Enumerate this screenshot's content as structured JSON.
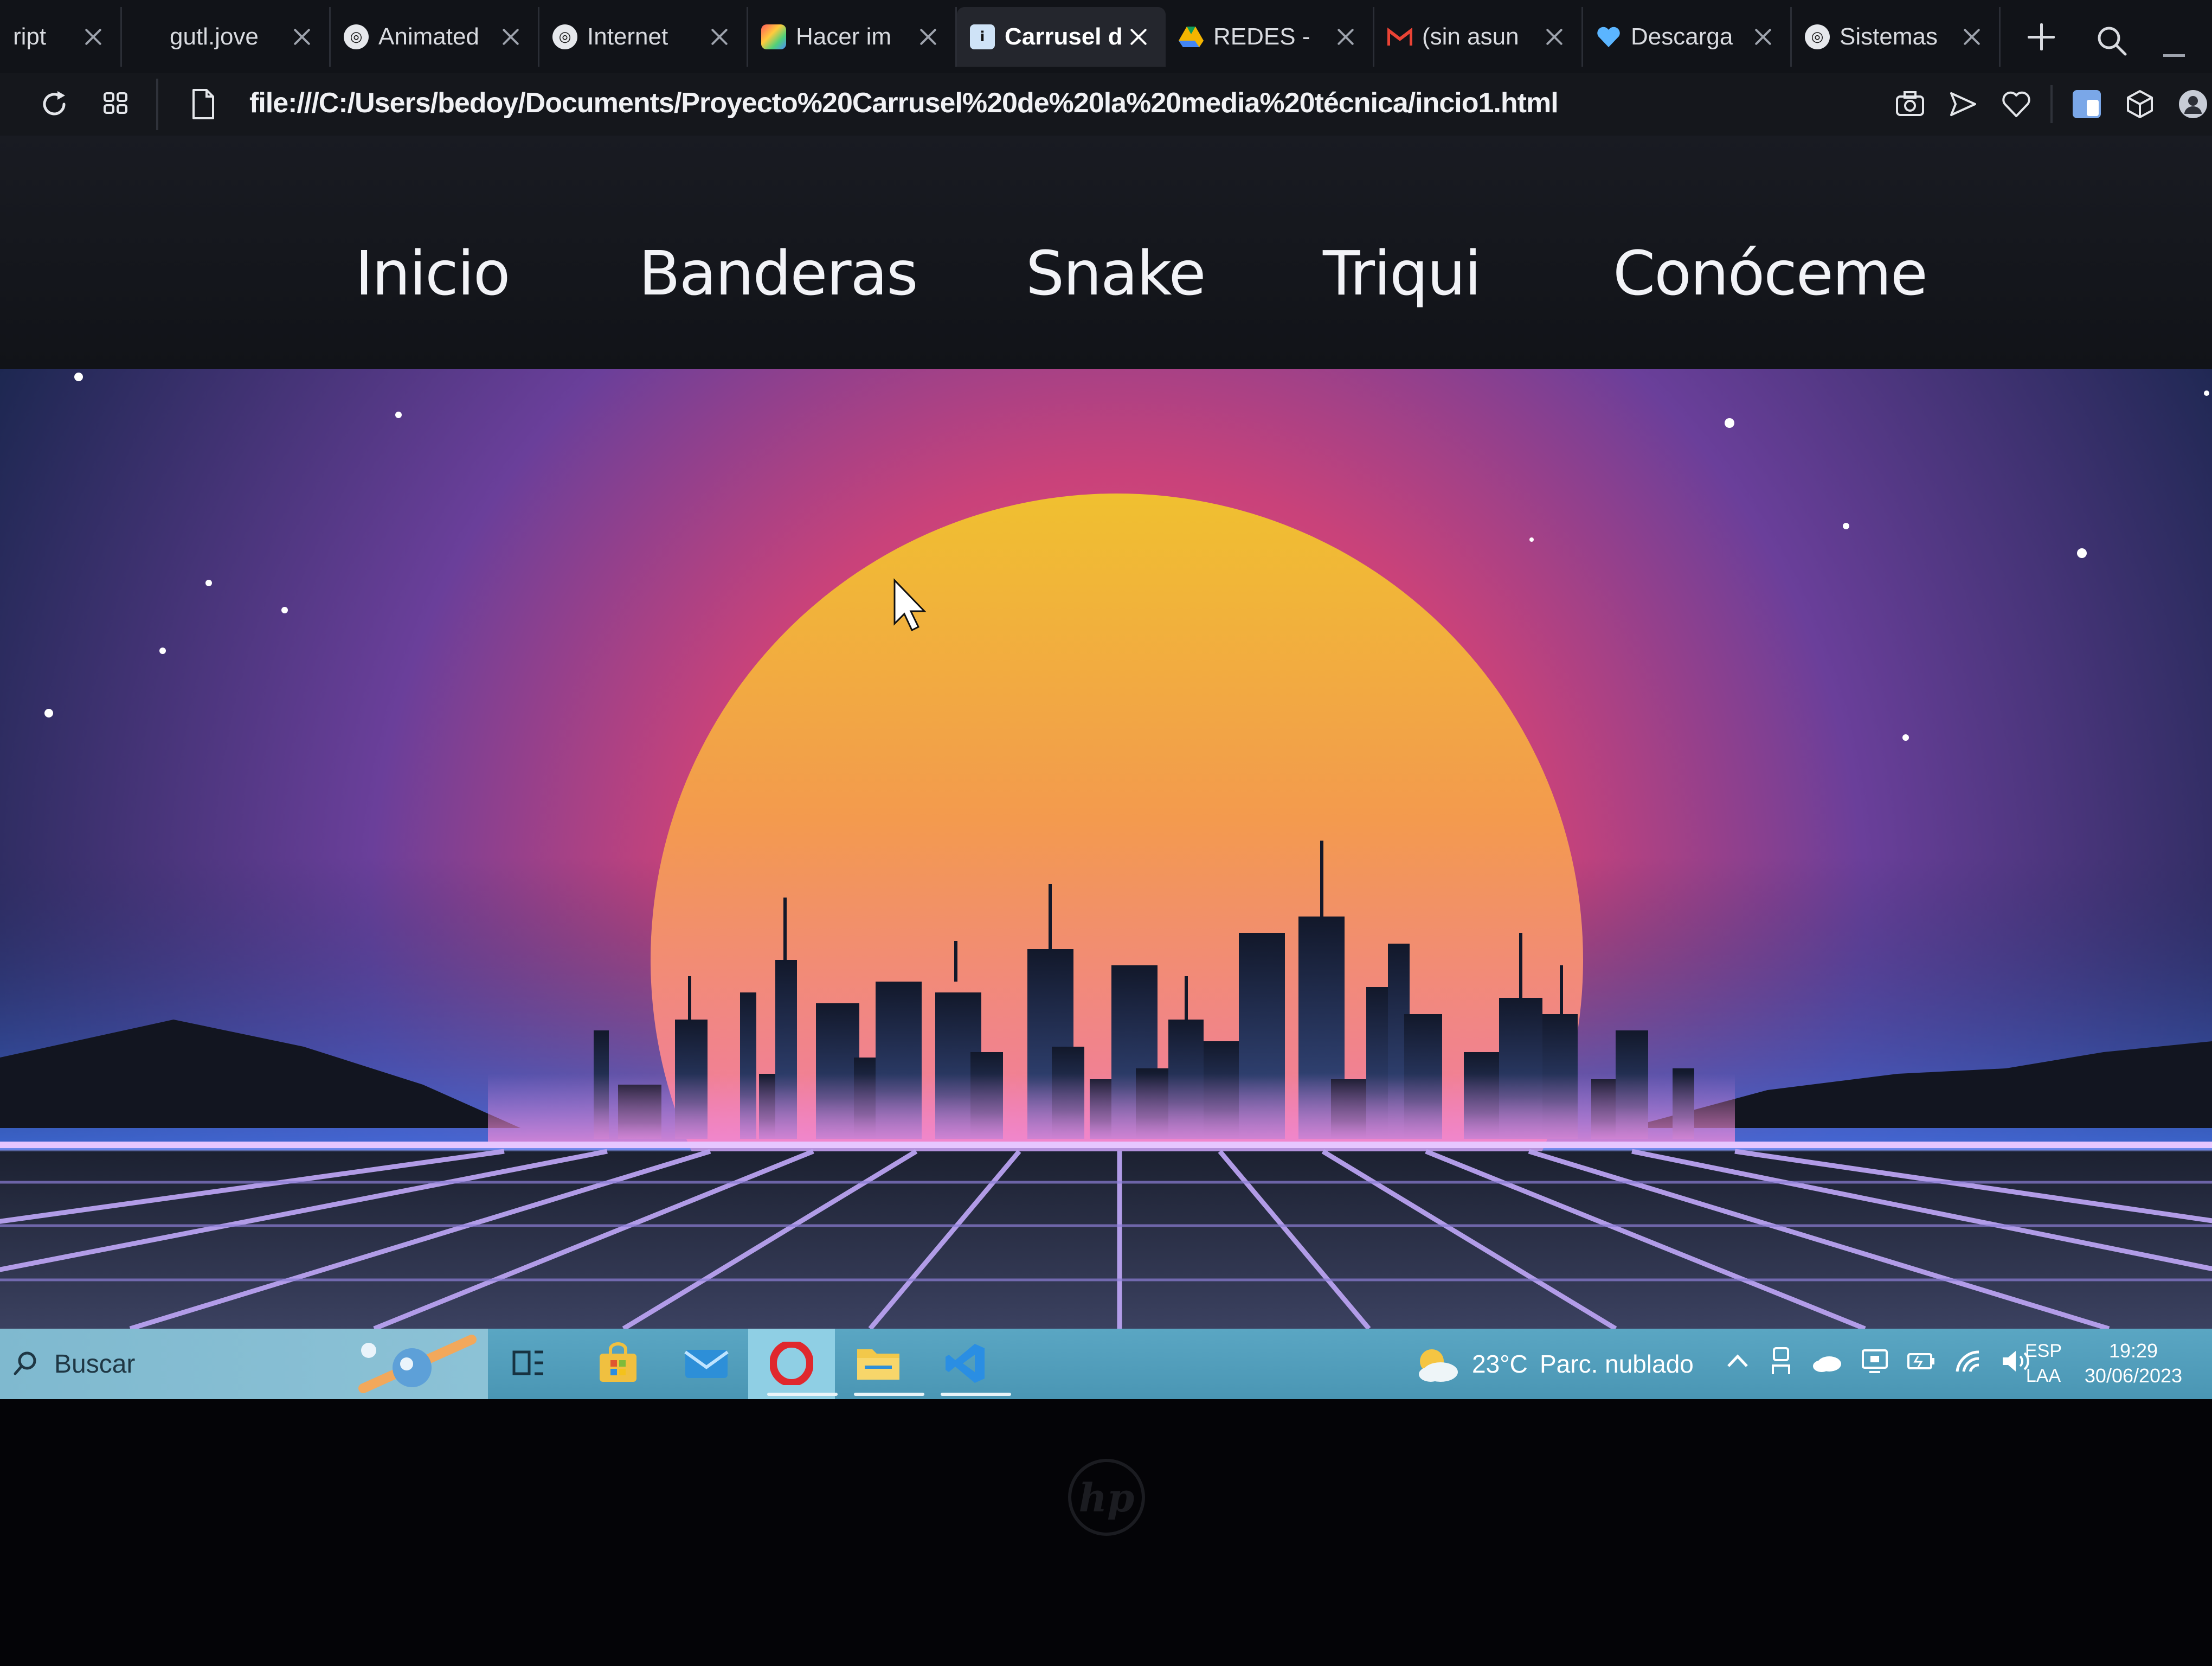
{
  "browser": {
    "tabs": [
      {
        "title": "ript",
        "favicon": "generic-icon",
        "active": false
      },
      {
        "title": "gutl.jove",
        "favicon": "none",
        "active": false
      },
      {
        "title": "Animated",
        "favicon": "globe-icon",
        "active": false
      },
      {
        "title": "Internet",
        "favicon": "globe-icon",
        "active": false
      },
      {
        "title": "Hacer im",
        "favicon": "colorful-app-icon",
        "active": false
      },
      {
        "title": "Carrusel d",
        "favicon": "document-icon",
        "active": true
      },
      {
        "title": "REDES -",
        "favicon": "drive-icon",
        "active": false
      },
      {
        "title": "(sin asun",
        "favicon": "gmail-icon",
        "active": false
      },
      {
        "title": "Descarga",
        "favicon": "heart-icon",
        "active": false
      },
      {
        "title": "Sistemas",
        "favicon": "globe-icon",
        "active": false
      }
    ],
    "url": "file:///C:/Users/bedoy/Documents/Proyecto%20Carrusel%20de%20la%20media%20técnica/incio1.html"
  },
  "site": {
    "nav": [
      "Inicio",
      "Banderas",
      "Snake",
      "Triqui",
      "Conóceme"
    ]
  },
  "hero": {
    "sun_colors": [
      "#f0c030",
      "#f39a4e",
      "#f07aa6",
      "#f58ad0"
    ],
    "sky_colors": [
      "#2a2f5a",
      "#8a3f8f",
      "#c9427a"
    ],
    "grid_color": "#b9a2f0"
  },
  "taskbar": {
    "search_placeholder": "Buscar",
    "weather_temp": "23°C",
    "weather_desc": "Parc. nublado",
    "lang_top": "ESP",
    "lang_bottom": "LAA",
    "time": "19:29",
    "date": "30/06/2023"
  },
  "hardware": {
    "logo": "hp"
  }
}
